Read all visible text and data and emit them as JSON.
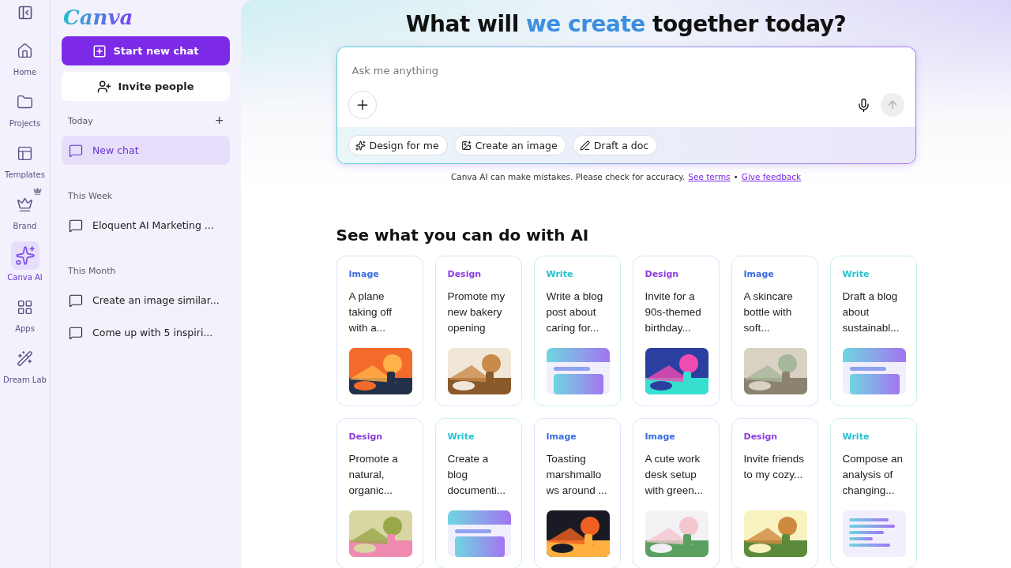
{
  "rail": {
    "items": [
      {
        "label": "Home",
        "selected": false,
        "premium": false
      },
      {
        "label": "Projects",
        "selected": false,
        "premium": false
      },
      {
        "label": "Templates",
        "selected": false,
        "premium": false
      },
      {
        "label": "Brand",
        "selected": false,
        "premium": true
      },
      {
        "label": "Canva AI",
        "selected": true,
        "premium": false
      },
      {
        "label": "Apps",
        "selected": false,
        "premium": false
      },
      {
        "label": "Dream Lab",
        "selected": false,
        "premium": false
      }
    ]
  },
  "sidebar": {
    "logo": "Canva",
    "start_button": "Start new chat",
    "invite_button": "Invite people",
    "sections": [
      {
        "heading": "Today",
        "add": "+",
        "items": [
          {
            "label": "New chat",
            "selected": true
          }
        ]
      },
      {
        "heading": "This Week",
        "items": [
          {
            "label": "Eloquent AI Marketing ...",
            "selected": false
          }
        ]
      },
      {
        "heading": "This Month",
        "items": [
          {
            "label": "Create an image similar...",
            "selected": false
          },
          {
            "label": "Come up with 5 inspiri...",
            "selected": false
          }
        ]
      }
    ]
  },
  "main": {
    "title": "What will **we create** together today?",
    "prompt": {
      "placeholder": "Ask me anything"
    },
    "chips": [
      "Design for me",
      "Create an image",
      "Draft a doc"
    ],
    "disclaimer": "Canva AI can make mistakes. Please check for accuracy.",
    "links": [
      "See terms",
      "Give feedback"
    ],
    "separator": "•",
    "section_title": "See what you can do with AI",
    "cards": [
      {
        "tag": "Image",
        "color": "#3b6de0",
        "text": "A plane taking off with a...",
        "kind": "picture"
      },
      {
        "tag": "Design",
        "color": "#8b3dde",
        "text": "Promote my new bakery opening",
        "kind": "picture"
      },
      {
        "tag": "Write",
        "color": "#26c2cf",
        "text": "Write a blog post about caring for...",
        "kind": "doc"
      },
      {
        "tag": "Design",
        "color": "#8b3dde",
        "text": "Invite for a 90s-themed birthday...",
        "kind": "picture"
      },
      {
        "tag": "Image",
        "color": "#3b6de0",
        "text": "A skincare bottle with soft...",
        "kind": "picture"
      },
      {
        "tag": "Write",
        "color": "#26c2cf",
        "text": "Draft a blog about sustainabl...",
        "kind": "doc"
      },
      {
        "tag": "Design",
        "color": "#8b3dde",
        "text": "Promote a natural, organic...",
        "kind": "picture"
      },
      {
        "tag": "Write",
        "color": "#26c2cf",
        "text": "Create a blog documenti...",
        "kind": "doc"
      },
      {
        "tag": "Image",
        "color": "#3b6de0",
        "text": "Toasting marshmallo ws around ...",
        "kind": "picture"
      },
      {
        "tag": "Image",
        "color": "#3b6de0",
        "text": "A cute work desk setup with green...",
        "kind": "picture"
      },
      {
        "tag": "Design",
        "color": "#8b3dde",
        "text": "Invite friends to my cozy...",
        "kind": "picture"
      },
      {
        "tag": "Write",
        "color": "#26c2cf",
        "text": "Compose an analysis of changing...",
        "kind": "lines"
      }
    ]
  }
}
